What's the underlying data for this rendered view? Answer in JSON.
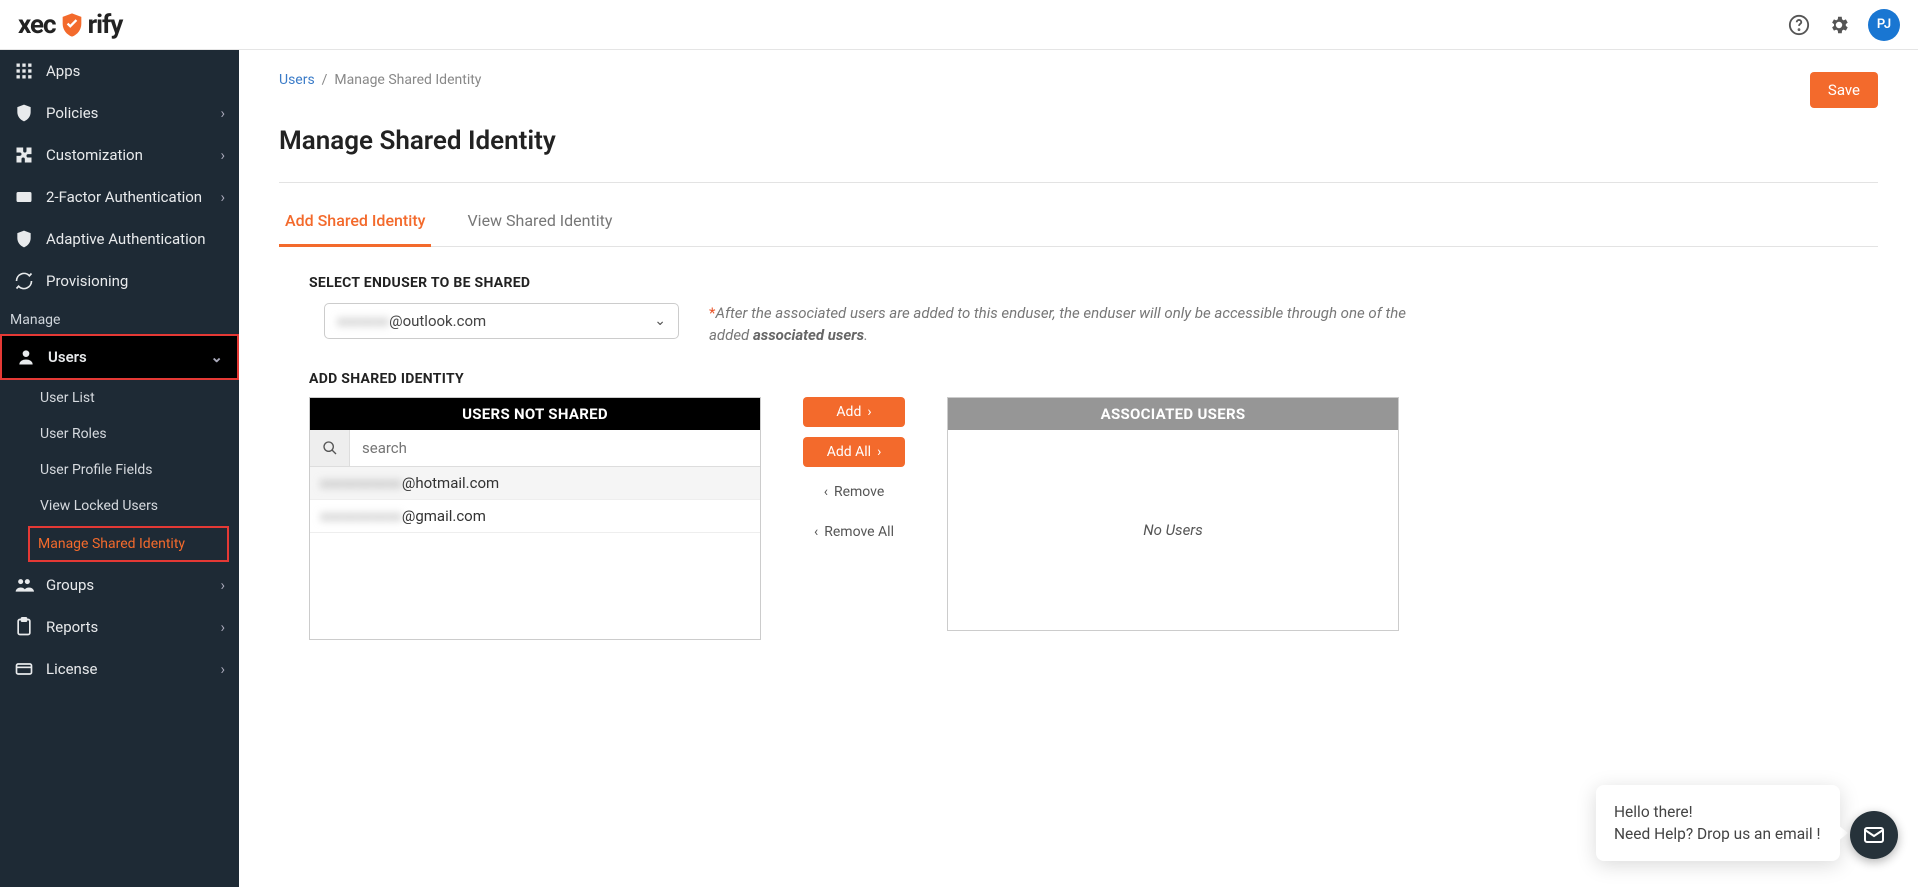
{
  "header": {
    "logo_a": "xec",
    "logo_b": "rify",
    "avatar": "PJ"
  },
  "sidebar": {
    "apps": "Apps",
    "policies": "Policies",
    "customization": "Customization",
    "twofa": "2-Factor Authentication",
    "adaptive": "Adaptive Authentication",
    "provisioning": "Provisioning",
    "manage_label": "Manage",
    "users": "Users",
    "users_sub": {
      "list": "User List",
      "roles": "User Roles",
      "profile": "User Profile Fields",
      "locked": "View Locked Users",
      "msi": "Manage Shared Identity"
    },
    "groups": "Groups",
    "reports": "Reports",
    "license": "License"
  },
  "breadcrumb": {
    "users": "Users",
    "sep": "/",
    "current": "Manage Shared Identity"
  },
  "save_btn": "Save",
  "page_title": "Manage Shared Identity",
  "tabs": {
    "add": "Add Shared Identity",
    "view": "View Shared Identity"
  },
  "select_hdr": "SELECT ENDUSER TO BE SHARED",
  "dropdown_blur": "xxxxxxx",
  "dropdown_rest": "@outlook.com",
  "note_pre": "After the associated users are added to this enduser, the enduser will only be accessible through one of the added ",
  "note_bold": "associated users",
  "add_hdr": "ADD SHARED IDENTITY",
  "left_box_hdr": "USERS NOT SHARED",
  "search_placeholder": "search",
  "users_not_shared": [
    {
      "blur": "xxxxxxxxxxx",
      "rest": "@hotmail.com"
    },
    {
      "blur": "xxxxxxxxxxx",
      "rest": "@gmail.com"
    }
  ],
  "btns": {
    "add": "Add",
    "addall": "Add All",
    "remove": "Remove",
    "removeall": "Remove All"
  },
  "right_box_hdr": "ASSOCIATED USERS",
  "no_users": "No Users",
  "chat": {
    "l1": "Hello there!",
    "l2": "Need Help? Drop us an email !"
  }
}
